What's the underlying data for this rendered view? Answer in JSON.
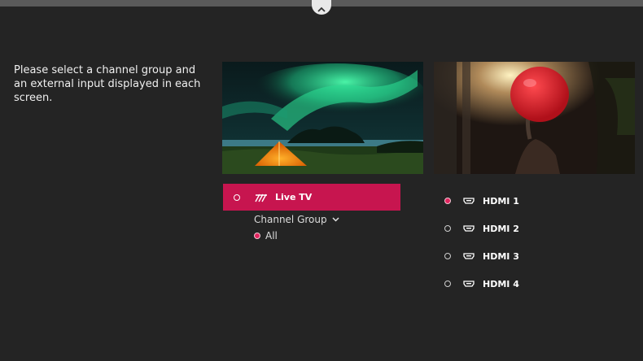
{
  "instruction": "Please select a channel group and an external input displayed in each screen.",
  "left_screen": {
    "source": {
      "label": "Live TV",
      "icon": "antenna-icon"
    },
    "channel_group": {
      "label": "Channel Group",
      "selected": "All"
    }
  },
  "right_screen": {
    "inputs": [
      {
        "label": "HDMI 1",
        "selected": true
      },
      {
        "label": "HDMI 2",
        "selected": false
      },
      {
        "label": "HDMI 3",
        "selected": false
      },
      {
        "label": "HDMI 4",
        "selected": false
      }
    ]
  },
  "colors": {
    "accent": "#c7154f",
    "background": "#242424",
    "selected_dot": "#e0245e"
  }
}
